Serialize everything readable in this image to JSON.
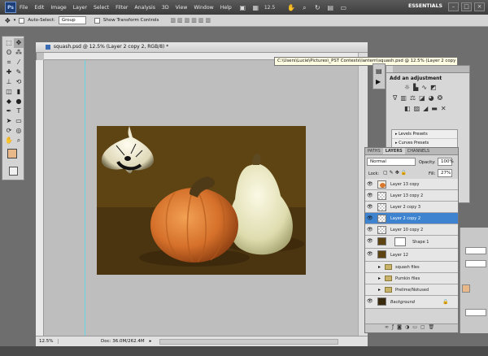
{
  "menubar": {
    "logo": "Ps",
    "items": [
      "File",
      "Edit",
      "Image",
      "Layer",
      "Select",
      "Filter",
      "Analysis",
      "3D",
      "View",
      "Window",
      "Help"
    ],
    "zoom": "12.5",
    "workspace": "ESSENTIALS"
  },
  "options": {
    "auto_select_label": "Auto-Select:",
    "auto_select_value": "Group",
    "transform_label": "Show Transform Controls"
  },
  "document": {
    "tab_title": "squash.psd @ 12.5% (Layer 2 copy 2, RGB/8) *",
    "zoom_status": "12.5%",
    "doc_size": "Doc: 36.0M/262.4M"
  },
  "tooltip": "C:\\Users\\Lucie\\Pictures\\_PST Contests\\lantern\\squash.psd @ 12.5% (Layer 2 copy 2, RGB/8) *",
  "adjustments": {
    "title": "Add an adjustment",
    "presets": [
      "Levels Presets",
      "Curves Presets"
    ]
  },
  "layers_panel": {
    "tabs": [
      "PATHS",
      "LAYERS",
      "CHANNELS"
    ],
    "blend_mode": "Normal",
    "opacity_label": "Opacity:",
    "opacity_value": "100%",
    "lock_label": "Lock:",
    "fill_label": "Fill:",
    "fill_value": "27%",
    "layers": [
      {
        "name": "Layer 13 copy",
        "type": "layer",
        "thumb": "pumpkin"
      },
      {
        "name": "Layer 13 copy 2",
        "type": "layer",
        "thumb": "blank"
      },
      {
        "name": "Layer 2 copy 3",
        "type": "layer",
        "thumb": "blank"
      },
      {
        "name": "Layer 2 copy 2",
        "type": "layer",
        "thumb": "blank",
        "selected": true
      },
      {
        "name": "Layer 10 copy 2",
        "type": "layer",
        "thumb": "blank"
      },
      {
        "name": "Shape 1",
        "type": "shape",
        "thumb": "brown"
      },
      {
        "name": "Layer 12",
        "type": "layer",
        "thumb": "brown"
      },
      {
        "name": "squash files",
        "type": "group"
      },
      {
        "name": "Pumkin files",
        "type": "group"
      },
      {
        "name": "Prelime/Notused",
        "type": "group"
      },
      {
        "name": "Background",
        "type": "background",
        "thumb": "bg"
      }
    ]
  },
  "colors": {
    "canvas_bg": "#5e4313",
    "floor": "#4b3510",
    "pumpkin": "#d9782a",
    "squash": "#e6e4bf",
    "selection": "#3d83cf",
    "foreground_swatch": "#e9b889"
  }
}
